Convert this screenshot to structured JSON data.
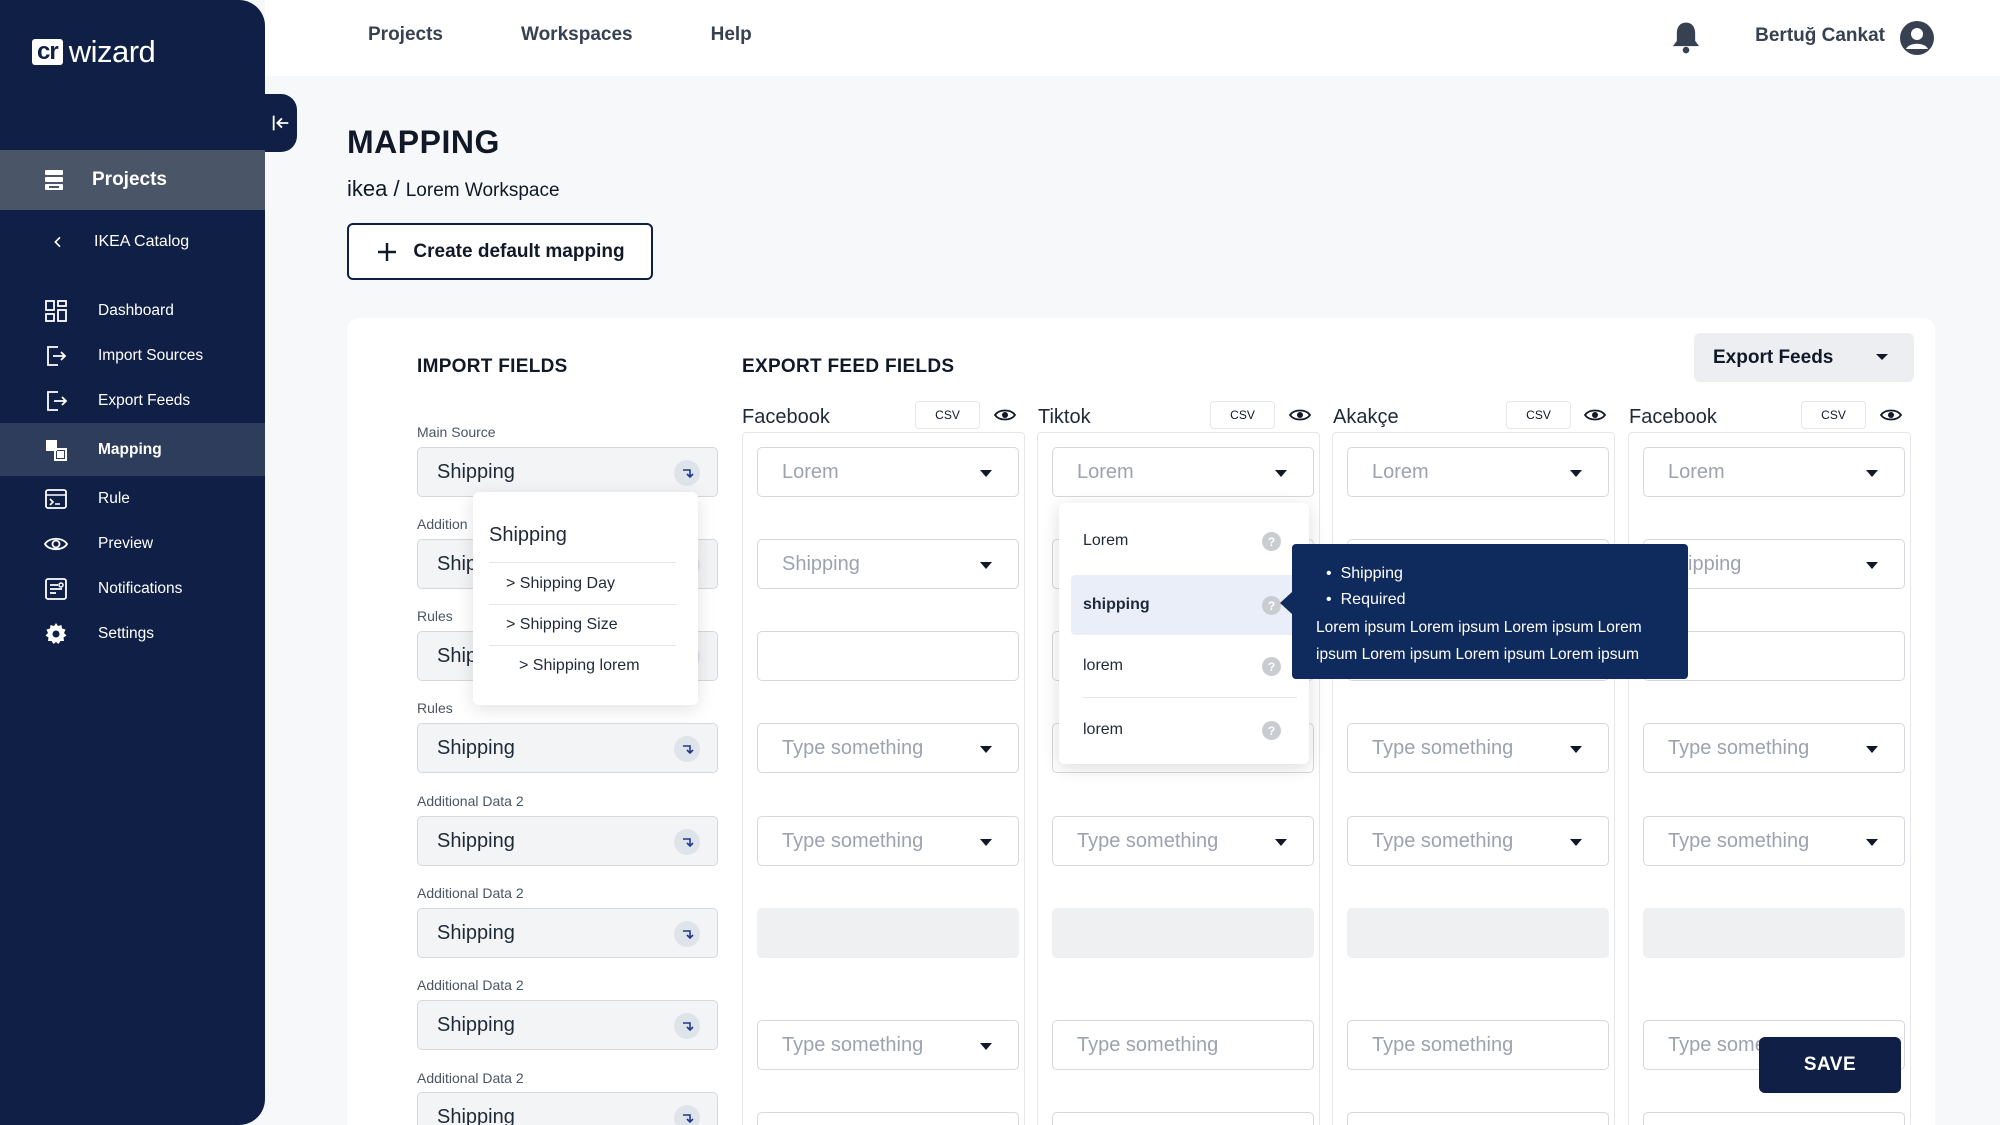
{
  "app": {
    "logo_box": "cr",
    "logo_text": "wizard"
  },
  "sidebar": {
    "projects_label": "Projects",
    "back_label": "IKEA Catalog",
    "items": [
      {
        "label": "Dashboard",
        "icon": "dashboard-icon"
      },
      {
        "label": "Import Sources",
        "icon": "import-icon"
      },
      {
        "label": "Export Feeds",
        "icon": "export-icon"
      },
      {
        "label": "Mapping",
        "icon": "mapping-icon",
        "active": true
      },
      {
        "label": "Rule",
        "icon": "rule-icon"
      },
      {
        "label": "Preview",
        "icon": "eye-icon"
      },
      {
        "label": "Notifications",
        "icon": "notifications-icon"
      },
      {
        "label": "Settings",
        "icon": "gear-icon"
      }
    ]
  },
  "topnav": {
    "projects": "Projects",
    "workspaces": "Workspaces",
    "help": "Help"
  },
  "user": {
    "name": "Bertuğ Cankat"
  },
  "page": {
    "title": "MAPPING",
    "breadcrumb_root": "ikea",
    "breadcrumb_sep": "/",
    "breadcrumb_sub": "Lorem Workspace",
    "create_button": "Create default mapping"
  },
  "sections": {
    "import_fields": "IMPORT FIELDS",
    "export_feed_fields": "EXPORT FEED FIELDS",
    "export_feeds_button": "Export Feeds"
  },
  "import_fields": [
    {
      "label": "Main Source",
      "value": "Shipping"
    },
    {
      "label": "Addition",
      "value": "Ship"
    },
    {
      "label": "Rules",
      "value": "Ship"
    },
    {
      "label": "Rules",
      "value": "Shipping"
    },
    {
      "label": "Additional Data 2",
      "value": "Shipping"
    },
    {
      "label": "Additional Data 2",
      "value": "Shipping"
    },
    {
      "label": "Additional Data 2",
      "value": "Shipping"
    },
    {
      "label": "Additional Data 2",
      "value": "Shipping"
    }
  ],
  "import_popup": {
    "title": "Shipping",
    "options": [
      "> Shipping Day",
      "> Shipping Size",
      "> Shipping lorem"
    ]
  },
  "export_columns": [
    {
      "name": "Facebook",
      "tag": "CSV",
      "cells": [
        "Lorem",
        "Shipping",
        "",
        "Type something",
        "Type something",
        "",
        "Type something"
      ]
    },
    {
      "name": "Tiktok",
      "tag": "CSV",
      "cells": [
        "Lorem",
        "",
        "",
        "",
        "Type something",
        "",
        "Type something"
      ]
    },
    {
      "name": "Akakçe",
      "tag": "CSV",
      "cells": [
        "Lorem",
        "",
        "",
        "Type something",
        "Type something",
        "",
        "Type something"
      ]
    },
    {
      "name": "Facebook",
      "tag": "CSV",
      "cells": [
        "Lorem",
        "ipping",
        "",
        "Type something",
        "Type something",
        "",
        "Type some"
      ]
    }
  ],
  "tiktok_menu": {
    "items": [
      {
        "label": "Lorem"
      },
      {
        "label": "shipping",
        "selected": true
      },
      {
        "label": "lorem"
      },
      {
        "label": "lorem"
      }
    ]
  },
  "tooltip": {
    "bullets": [
      "Shipping",
      "Required"
    ],
    "text": "Lorem ipsum Lorem ipsum Lorem ipsum Lorem ipsum Lorem ipsum Lorem ipsum Lorem ipsum"
  },
  "save_button": "SAVE",
  "colors": {
    "sidebar": "#0f1f45",
    "tooltip": "#0f2a5c",
    "active_nav": "#4b5568"
  }
}
